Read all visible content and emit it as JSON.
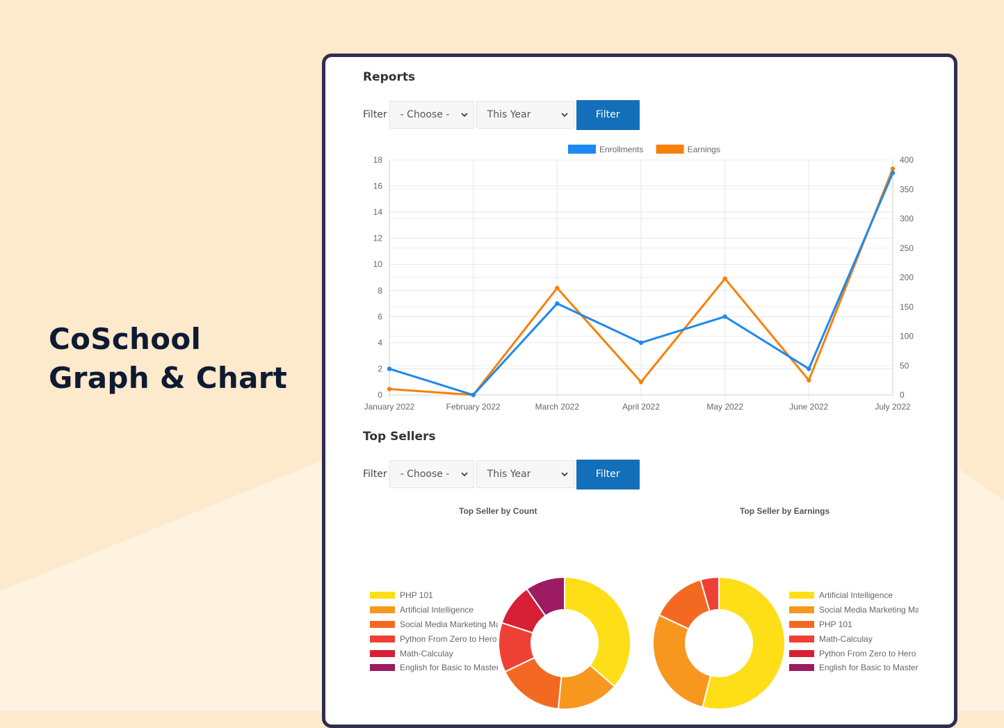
{
  "hero": {
    "line1": "CoSchool",
    "line2": "Graph & Chart"
  },
  "reports": {
    "title": "Reports",
    "filter_label": "Filter",
    "select_course": "- Choose -",
    "select_period": "This Year",
    "filter_button": "Filter"
  },
  "top_sellers": {
    "title": "Top Sellers",
    "filter_label": "Filter",
    "select_course": "- Choose -",
    "select_period": "This Year",
    "filter_button": "Filter"
  },
  "colors": {
    "enrollments": "#1e88f0",
    "earnings": "#f7800a",
    "background": "#fde9cc",
    "frame_border": "#2f2e51",
    "button": "#136fb9"
  },
  "chart_data": [
    {
      "type": "line",
      "categories": [
        "January 2022",
        "February 2022",
        "March 2022",
        "April 2022",
        "May 2022",
        "June 2022",
        "July 2022"
      ],
      "series": [
        {
          "name": "Enrollments",
          "axis": "left",
          "color": "#1e88f0",
          "values": [
            2,
            0,
            7,
            4,
            6,
            2,
            17
          ]
        },
        {
          "name": "Earnings",
          "axis": "right",
          "color": "#f7800a",
          "values": [
            10,
            0,
            182,
            22,
            198,
            25,
            385
          ]
        }
      ],
      "y_left": {
        "min": 0,
        "max": 18,
        "ticks": [
          0,
          2,
          4,
          6,
          8,
          10,
          12,
          14,
          16,
          18
        ]
      },
      "y_right": {
        "min": 0,
        "max": 400,
        "ticks": [
          0,
          50,
          100,
          150,
          200,
          250,
          300,
          350,
          400
        ]
      },
      "legend_position": "top",
      "grid": true
    },
    {
      "type": "pie",
      "title": "Top Seller by Count",
      "legend_position": "left",
      "labels": [
        "PHP 101",
        "Artificial Intelligence",
        "Social Media Marketing Ma",
        "Python From Zero to Hero",
        "Math-Calculay",
        "English for Basic to Mastery"
      ],
      "values": [
        6,
        2.5,
        2.7,
        2,
        1.7,
        1.6
      ],
      "colors": [
        "#fede17",
        "#f7971e",
        "#f46922",
        "#ef4035",
        "#d71f36",
        "#9c1b62"
      ]
    },
    {
      "type": "pie",
      "title": "Top Seller by Earnings",
      "legend_position": "right",
      "labels": [
        "Artificial Intelligence",
        "Social Media Marketing Ma",
        "PHP 101",
        "Math-Calculay",
        "Python From Zero to Hero",
        "English for Basic to Mastery"
      ],
      "values": [
        54,
        28,
        13.5,
        4.5,
        0,
        0
      ],
      "colors": [
        "#fede17",
        "#f7971e",
        "#f46922",
        "#ef4035",
        "#d71f36",
        "#9c1b62"
      ]
    }
  ]
}
